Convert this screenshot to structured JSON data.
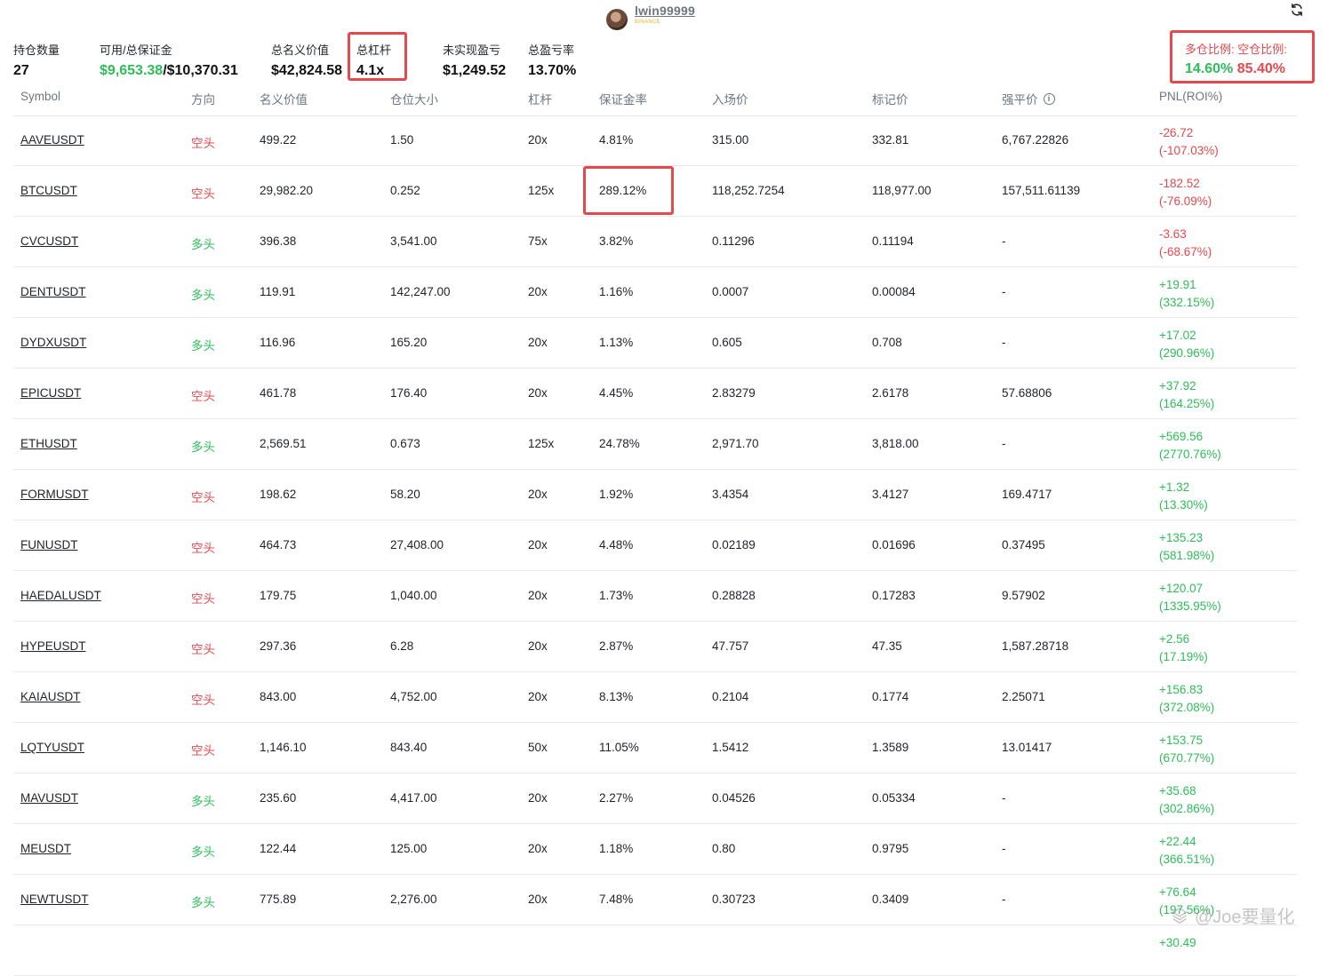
{
  "user": {
    "name": "lwin99999",
    "exchange": "BINANCE"
  },
  "stats": {
    "positions_label": "持仓数量",
    "positions_value": "27",
    "margin_label": "可用/总保证金",
    "margin_available": "$9,653.38",
    "margin_total": "/$10,370.31",
    "notional_label": "总名义价值",
    "notional_value": "$42,824.58",
    "leverage_label": "总杠杆",
    "leverage_value": "4.1x",
    "upnl_label": "未实现盈亏",
    "upnl_value": "$1,249.52",
    "pnl_rate_label": "总盈亏率",
    "pnl_rate_value": "13.70%",
    "long_label": "多仓比例:",
    "short_label": "空仓比例:",
    "long_value": "14.60%",
    "short_value": "85.40%"
  },
  "columns": [
    "Symbol",
    "方向",
    "名义价值",
    "仓位大小",
    "杠杆",
    "保证金率",
    "入场价",
    "标记价",
    "强平价",
    "PNL(ROI%)"
  ],
  "info_glyph": "i",
  "rows": [
    {
      "symbol": "AAVEUSDT",
      "side": "空头",
      "notional": "499.22",
      "size": "1.50",
      "leverage": "20x",
      "margin_ratio": "4.81%",
      "entry": "315.00",
      "mark": "332.81",
      "liq": "6,767.22826",
      "pnl": "-26.72",
      "roi": "(-107.03%)"
    },
    {
      "symbol": "BTCUSDT",
      "side": "空头",
      "notional": "29,982.20",
      "size": "0.252",
      "leverage": "125x",
      "margin_ratio": "289.12%",
      "entry": "118,252.7254",
      "mark": "118,977.00",
      "liq": "157,511.61139",
      "pnl": "-182.52",
      "roi": "(-76.09%)"
    },
    {
      "symbol": "CVCUSDT",
      "side": "多头",
      "notional": "396.38",
      "size": "3,541.00",
      "leverage": "75x",
      "margin_ratio": "3.82%",
      "entry": "0.11296",
      "mark": "0.11194",
      "liq": "-",
      "pnl": "-3.63",
      "roi": "(-68.67%)"
    },
    {
      "symbol": "DENTUSDT",
      "side": "多头",
      "notional": "119.91",
      "size": "142,247.00",
      "leverage": "20x",
      "margin_ratio": "1.16%",
      "entry": "0.0007",
      "mark": "0.00084",
      "liq": "-",
      "pnl": "+19.91",
      "roi": "(332.15%)"
    },
    {
      "symbol": "DYDXUSDT",
      "side": "多头",
      "notional": "116.96",
      "size": "165.20",
      "leverage": "20x",
      "margin_ratio": "1.13%",
      "entry": "0.605",
      "mark": "0.708",
      "liq": "-",
      "pnl": "+17.02",
      "roi": "(290.96%)"
    },
    {
      "symbol": "EPICUSDT",
      "side": "空头",
      "notional": "461.78",
      "size": "176.40",
      "leverage": "20x",
      "margin_ratio": "4.45%",
      "entry": "2.83279",
      "mark": "2.6178",
      "liq": "57.68806",
      "pnl": "+37.92",
      "roi": "(164.25%)"
    },
    {
      "symbol": "ETHUSDT",
      "side": "多头",
      "notional": "2,569.51",
      "size": "0.673",
      "leverage": "125x",
      "margin_ratio": "24.78%",
      "entry": "2,971.70",
      "mark": "3,818.00",
      "liq": "-",
      "pnl": "+569.56",
      "roi": "(2770.76%)"
    },
    {
      "symbol": "FORMUSDT",
      "side": "空头",
      "notional": "198.62",
      "size": "58.20",
      "leverage": "20x",
      "margin_ratio": "1.92%",
      "entry": "3.4354",
      "mark": "3.4127",
      "liq": "169.4717",
      "pnl": "+1.32",
      "roi": "(13.30%)"
    },
    {
      "symbol": "FUNUSDT",
      "side": "空头",
      "notional": "464.73",
      "size": "27,408.00",
      "leverage": "20x",
      "margin_ratio": "4.48%",
      "entry": "0.02189",
      "mark": "0.01696",
      "liq": "0.37495",
      "pnl": "+135.23",
      "roi": "(581.98%)"
    },
    {
      "symbol": "HAEDALUSDT",
      "side": "空头",
      "notional": "179.75",
      "size": "1,040.00",
      "leverage": "20x",
      "margin_ratio": "1.73%",
      "entry": "0.28828",
      "mark": "0.17283",
      "liq": "9.57902",
      "pnl": "+120.07",
      "roi": "(1335.95%)"
    },
    {
      "symbol": "HYPEUSDT",
      "side": "空头",
      "notional": "297.36",
      "size": "6.28",
      "leverage": "20x",
      "margin_ratio": "2.87%",
      "entry": "47.757",
      "mark": "47.35",
      "liq": "1,587.28718",
      "pnl": "+2.56",
      "roi": "(17.19%)"
    },
    {
      "symbol": "KAIAUSDT",
      "side": "空头",
      "notional": "843.00",
      "size": "4,752.00",
      "leverage": "20x",
      "margin_ratio": "8.13%",
      "entry": "0.2104",
      "mark": "0.1774",
      "liq": "2.25071",
      "pnl": "+156.83",
      "roi": "(372.08%)"
    },
    {
      "symbol": "LQTYUSDT",
      "side": "空头",
      "notional": "1,146.10",
      "size": "843.40",
      "leverage": "50x",
      "margin_ratio": "11.05%",
      "entry": "1.5412",
      "mark": "1.3589",
      "liq": "13.01417",
      "pnl": "+153.75",
      "roi": "(670.77%)"
    },
    {
      "symbol": "MAVUSDT",
      "side": "多头",
      "notional": "235.60",
      "size": "4,417.00",
      "leverage": "20x",
      "margin_ratio": "2.27%",
      "entry": "0.04526",
      "mark": "0.05334",
      "liq": "-",
      "pnl": "+35.68",
      "roi": "(302.86%)"
    },
    {
      "symbol": "MEUSDT",
      "side": "多头",
      "notional": "122.44",
      "size": "125.00",
      "leverage": "20x",
      "margin_ratio": "1.18%",
      "entry": "0.80",
      "mark": "0.9795",
      "liq": "-",
      "pnl": "+22.44",
      "roi": "(366.51%)"
    },
    {
      "symbol": "NEWTUSDT",
      "side": "多头",
      "notional": "775.89",
      "size": "2,276.00",
      "leverage": "20x",
      "margin_ratio": "7.48%",
      "entry": "0.30723",
      "mark": "0.3409",
      "liq": "-",
      "pnl": "+76.64",
      "roi": "(197.56%)"
    },
    {
      "symbol": "",
      "side": "",
      "notional": "",
      "size": "",
      "leverage": "",
      "margin_ratio": "",
      "entry": "",
      "mark": "",
      "liq": "",
      "pnl": "+30.49",
      "roi": ""
    }
  ],
  "watermark": "@Joe要量化",
  "colors": {
    "long": "#2ebd59",
    "short": "#e5484d",
    "highlight": "#e5484d",
    "header_text": "#6e7681"
  }
}
